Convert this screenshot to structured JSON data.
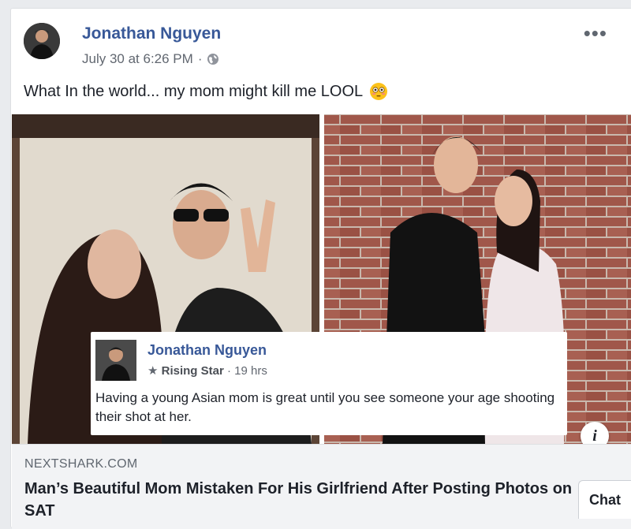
{
  "post": {
    "author": "Jonathan Nguyen",
    "timestamp": "July 30 at 6:26 PM",
    "separator": "·",
    "audience_icon": "globe-icon",
    "more_label": "•••",
    "text": "What In the world... my mom might kill me LOOL",
    "emoji_icon": "flushed-face-emoji-icon"
  },
  "embedded_post": {
    "author": "Jonathan Nguyen",
    "badge": "Rising Star",
    "time": "19 hrs",
    "separator": "·",
    "text": "Having a young Asian mom is great until you see someone your age shooting their shot at her."
  },
  "link_preview": {
    "domain": "NEXTSHARK.COM",
    "headline": "Man’s Beautiful Mom Mistaken For His Girlfriend After Posting Photos on SAT",
    "info_label": "i"
  },
  "chat": {
    "label": "Chat"
  },
  "colors": {
    "link_blue": "#385898",
    "meta_gray": "#616770",
    "footer_bg": "#f2f3f5",
    "brick": "#a0574a"
  }
}
